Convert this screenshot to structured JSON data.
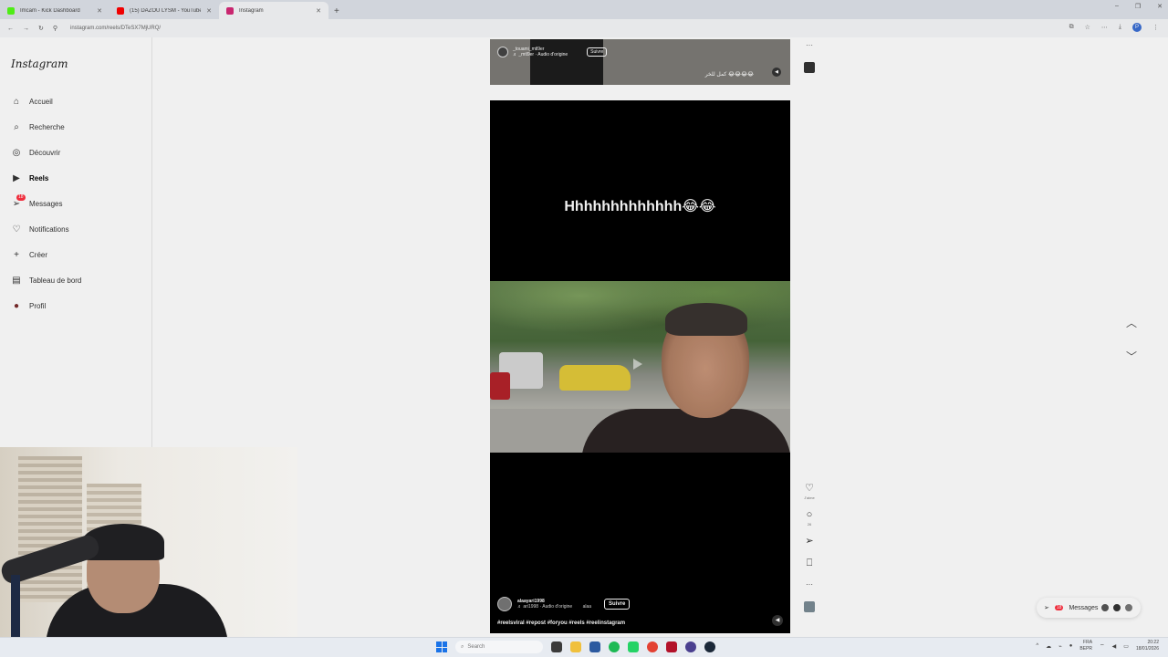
{
  "browser": {
    "tabs": [
      {
        "title": "Imcam - Kick Dashboard",
        "fav_color": "#53fc18"
      },
      {
        "title": "(15) DAZOU LYSM - YouTube",
        "fav_color": "#ff0000"
      },
      {
        "title": "Instagram",
        "fav_color": "#d62976"
      }
    ],
    "new_tab": "+",
    "url": "instagram.com/reels/DTeSX7MjURQ/",
    "profile_initial": "P"
  },
  "sidebar": {
    "logo": "Instagram",
    "items": [
      {
        "label": "Accueil",
        "icon": "⌂"
      },
      {
        "label": "Recherche",
        "icon": "⌕"
      },
      {
        "label": "Découvrir",
        "icon": "◎"
      },
      {
        "label": "Reels",
        "icon": "▶"
      },
      {
        "label": "Messages",
        "icon": "➢",
        "badge": "18"
      },
      {
        "label": "Notifications",
        "icon": "♡"
      },
      {
        "label": "Créer",
        "icon": "+"
      },
      {
        "label": "Tableau de bord",
        "icon": "▤"
      },
      {
        "label": "Profil",
        "icon": "●"
      }
    ]
  },
  "prev_reel": {
    "username": "_touami_mtl9er",
    "audio": "♬ _mtl9er · Audio d'origine",
    "follow": "Suivre",
    "caption": "كمل للخر 😂😂😂😂"
  },
  "reel": {
    "overlay_text": "Hhhhhhhhhhhhh😂😂",
    "username": "alaayari1998",
    "audio": "♬ ari1998 · Audio d'origine",
    "audio_extra": "alaa",
    "follow": "Suivre",
    "hashtags": "#reelsviral #repost #foryou #reels #reelinstagram"
  },
  "actions": {
    "like_label": "J'aime",
    "comments_count": "26",
    "more": "···"
  },
  "messages_pill": {
    "label": "Messages",
    "badge": "18"
  },
  "taskbar": {
    "search_placeholder": "Search",
    "lang": "FRA",
    "lang_sub": "BEPR",
    "time": "20:22",
    "date": "18/01/2026"
  }
}
